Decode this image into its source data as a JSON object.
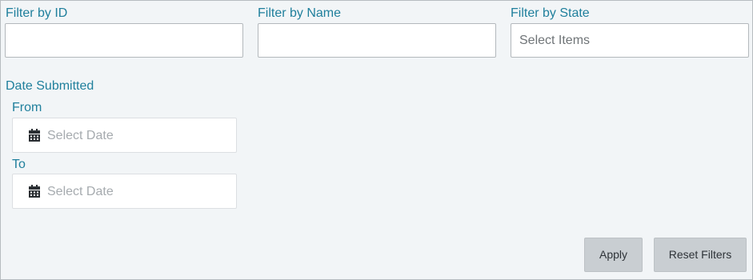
{
  "filters": {
    "id": {
      "label": "Filter by ID",
      "value": ""
    },
    "name": {
      "label": "Filter by Name",
      "value": ""
    },
    "state": {
      "label": "Filter by State",
      "placeholder": "Select Items"
    }
  },
  "date_submitted": {
    "label": "Date Submitted",
    "from": {
      "label": "From",
      "placeholder": "Select Date",
      "icon": "calendar-icon"
    },
    "to": {
      "label": "To",
      "placeholder": "Select Date",
      "icon": "calendar-icon"
    }
  },
  "actions": {
    "apply_label": "Apply",
    "reset_label": "Reset Filters"
  },
  "colors": {
    "label": "#1f7f9c",
    "panel_bg": "#f2f5f7",
    "button_bg": "#c9ced2"
  }
}
